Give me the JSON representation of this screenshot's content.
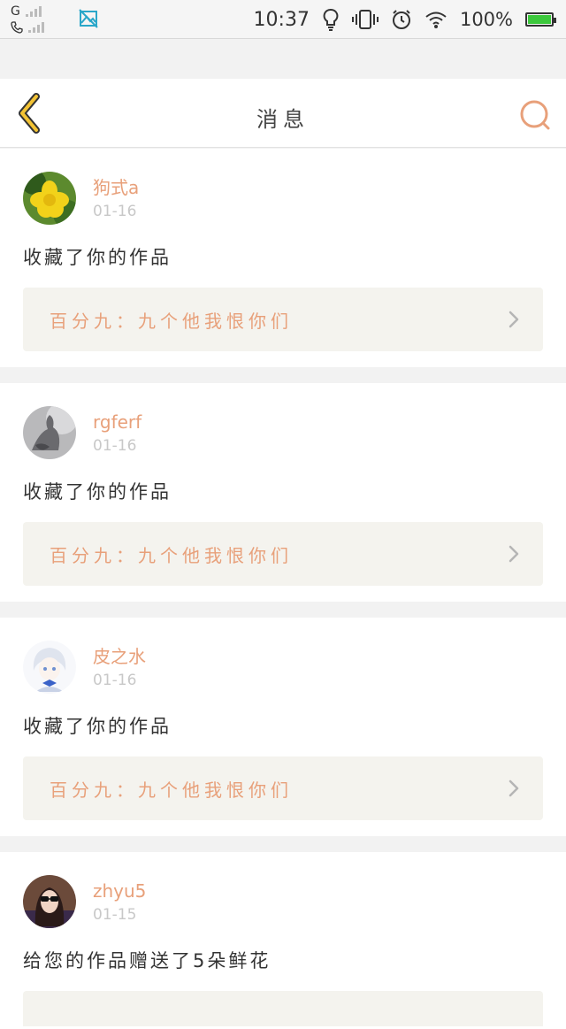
{
  "status_bar": {
    "carrier": "G",
    "time": "10:37",
    "battery": "100%",
    "icons": [
      "signal-icon",
      "phone-signal-icon",
      "image-icon",
      "bulb-icon",
      "vibrate-icon",
      "alarm-icon",
      "wifi-icon",
      "battery-icon"
    ]
  },
  "nav": {
    "title": "消息",
    "back_icon": "chevron-left-icon",
    "search_icon": "search-icon"
  },
  "colors": {
    "accent": "#e8a07a",
    "back_icon": "#f3c334",
    "battery_fill": "#3cc83c",
    "card_link_bg": "#f4f3ee"
  },
  "messages": [
    {
      "username": "狗式a",
      "date": "01-16",
      "action": "收藏了你的作品",
      "work_title": "百分九：九个他我恨你们",
      "avatar": "yellow-flower-avatar"
    },
    {
      "username": "rgferf",
      "date": "01-16",
      "action": "收藏了你的作品",
      "work_title": "百分九：九个他我恨你们",
      "avatar": "gray-figure-avatar"
    },
    {
      "username": "皮之水",
      "date": "01-16",
      "action": "收藏了你的作品",
      "work_title": "百分九：九个他我恨你们",
      "avatar": "anime-girl-avatar"
    },
    {
      "username": "zhyu5",
      "date": "01-15",
      "action": "给您的作品赠送了5朵鲜花",
      "work_title": "",
      "avatar": "sunglasses-girl-avatar"
    }
  ]
}
